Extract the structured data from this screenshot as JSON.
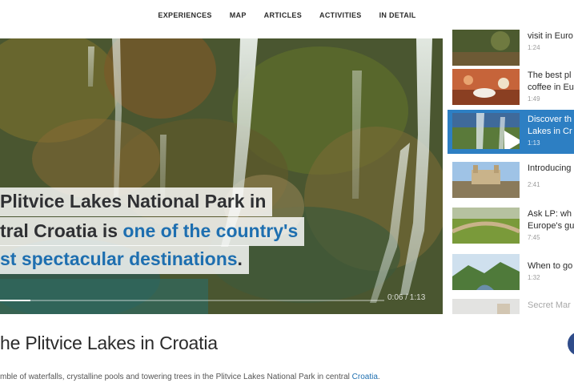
{
  "nav": {
    "items": [
      "EXPERIENCES",
      "MAP",
      "ARTICLES",
      "ACTIVITIES",
      "IN DETAIL"
    ]
  },
  "player": {
    "caption": {
      "line1": "Plitvice Lakes National Park in",
      "line2_plain": "tral Croatia is ",
      "line2_highlight": "one of the country's",
      "line3_highlight": "st spectacular destinations",
      "line3_plain": "."
    },
    "time": "0:06 / 1:13",
    "progress_fraction": 0.08
  },
  "playlist": {
    "items": [
      {
        "title": "visit in Euro",
        "duration": "1:24",
        "active": false
      },
      {
        "title": "The best pl",
        "title2": "coffee in Eu",
        "duration": "1:49",
        "active": false
      },
      {
        "title": "Discover th",
        "title2": "Lakes in Cr",
        "duration": "1:13",
        "active": true
      },
      {
        "title": "Introducing",
        "duration": "2:41",
        "active": false
      },
      {
        "title": "Ask LP: wh",
        "title2": "Europe's gu",
        "duration": "7:45",
        "active": false
      },
      {
        "title": "When to go",
        "duration": "1:32",
        "active": false
      },
      {
        "title": "Secret Mar",
        "duration": "",
        "active": false
      }
    ]
  },
  "page": {
    "title": "he Plitvice Lakes in Croatia",
    "description": "mble of waterfalls, crystalline pools and towering trees in the Plitvice Lakes National Park in central ",
    "description_link": "Croatia",
    "description_end": "."
  },
  "colors": {
    "accent": "#2d7fc3",
    "highlight_text": "#1e6fb0"
  }
}
